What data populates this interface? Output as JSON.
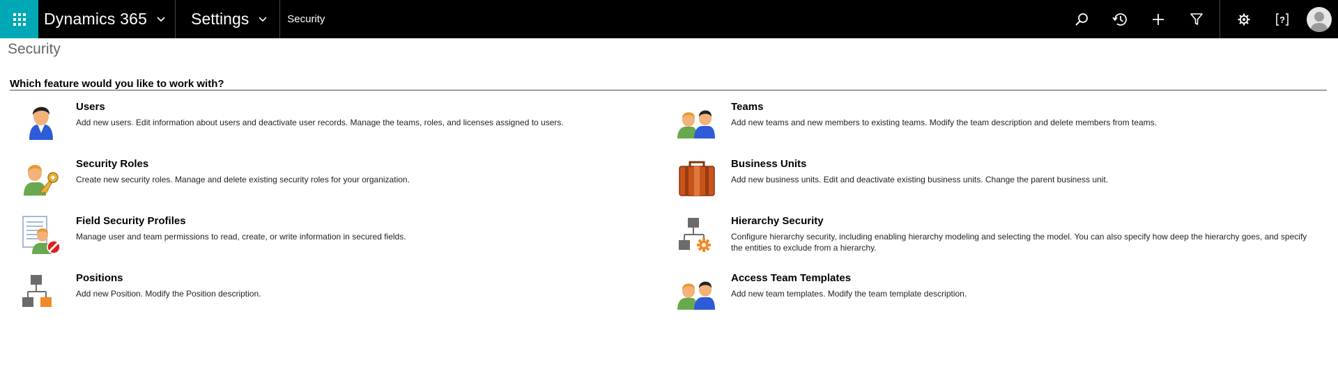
{
  "header": {
    "app_name": "Dynamics 365",
    "area_name": "Settings",
    "breadcrumb": "Security",
    "icons": [
      "app-launcher-icon",
      "search-icon",
      "recent-icon",
      "add-icon",
      "filter-icon",
      "settings-icon",
      "help-icon",
      "user-avatar-icon"
    ],
    "colors": {
      "bar": "#000000",
      "launcher": "#00a7b5"
    }
  },
  "page": {
    "title": "Security",
    "question": "Which feature would you like to work with?"
  },
  "features": [
    {
      "icon": "users-icon",
      "title": "Users",
      "description": "Add new users. Edit information about users and deactivate user records. Manage the teams, roles, and licenses assigned to users."
    },
    {
      "icon": "teams-icon",
      "title": "Teams",
      "description": "Add new teams and new members to existing teams. Modify the team description and delete members from teams."
    },
    {
      "icon": "security-roles-icon",
      "title": "Security Roles",
      "description": "Create new security roles. Manage and delete existing security roles for your organization."
    },
    {
      "icon": "business-units-icon",
      "title": "Business Units",
      "description": "Add new business units. Edit and deactivate existing business units. Change the parent business unit."
    },
    {
      "icon": "field-security-icon",
      "title": "Field Security Profiles",
      "description": "Manage user and team permissions to read, create, or write information in secured fields."
    },
    {
      "icon": "hierarchy-security-icon",
      "title": "Hierarchy Security",
      "description": "Configure hierarchy security, including enabling hierarchy modeling and selecting the model. You can also specify how deep the hierarchy goes, and specify the entities to exclude from a hierarchy."
    },
    {
      "icon": "positions-icon",
      "title": "Positions",
      "description": "Add new Position. Modify the Position description."
    },
    {
      "icon": "access-team-templates-icon",
      "title": "Access Team Templates",
      "description": "Add new team templates. Modify the team template description."
    }
  ]
}
